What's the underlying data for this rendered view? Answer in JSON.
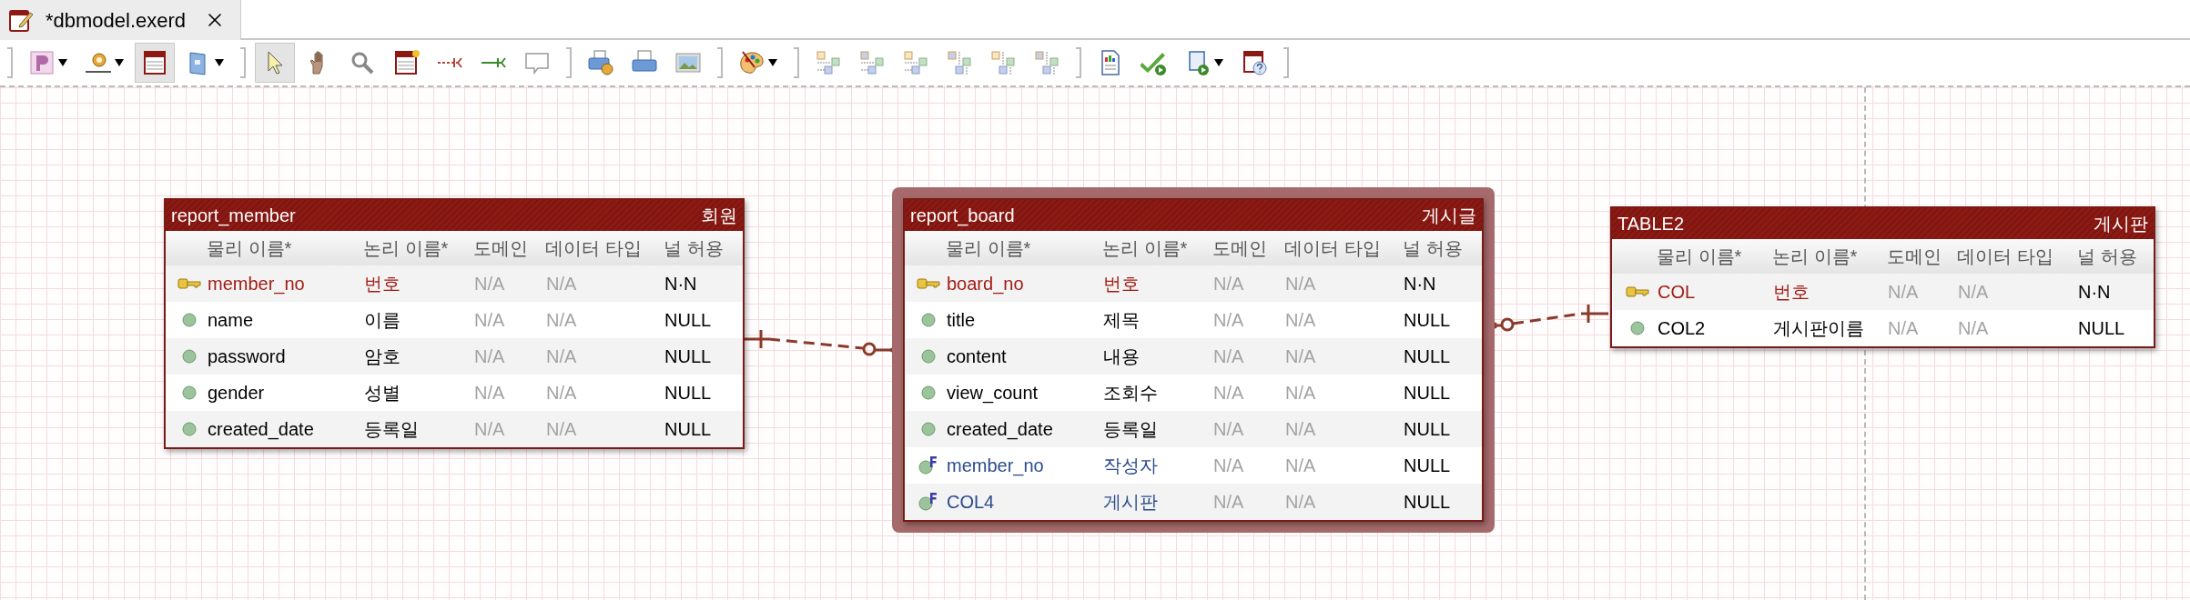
{
  "tab": {
    "title": "*dbmodel.exerd",
    "selected": true
  },
  "toolbar": {
    "groups": [
      [
        {
          "kind": "logical-view",
          "dropdown": true,
          "pressed": false
        },
        {
          "kind": "gear-line",
          "dropdown": true,
          "pressed": false
        },
        {
          "kind": "table-view",
          "dropdown": false,
          "pressed": true
        },
        {
          "kind": "book",
          "dropdown": true,
          "pressed": false
        }
      ],
      [
        {
          "kind": "pointer",
          "dropdown": false,
          "pressed": true
        },
        {
          "kind": "hand",
          "dropdown": false,
          "pressed": false
        },
        {
          "kind": "zoom",
          "dropdown": false,
          "pressed": false
        },
        {
          "kind": "new-table",
          "dropdown": false,
          "pressed": false
        },
        {
          "kind": "dashed-relation",
          "dropdown": false,
          "pressed": false
        },
        {
          "kind": "solid-relation",
          "dropdown": false,
          "pressed": false
        },
        {
          "kind": "note",
          "dropdown": false,
          "pressed": false
        }
      ],
      [
        {
          "kind": "print-settings",
          "dropdown": false,
          "pressed": false
        },
        {
          "kind": "print",
          "dropdown": false,
          "pressed": false
        },
        {
          "kind": "image",
          "dropdown": false,
          "pressed": false
        }
      ],
      [
        {
          "kind": "palette",
          "dropdown": true,
          "pressed": false
        }
      ],
      [
        {
          "kind": "layout-a",
          "dropdown": false,
          "pressed": false
        },
        {
          "kind": "layout-b",
          "dropdown": false,
          "pressed": false
        },
        {
          "kind": "layout-c",
          "dropdown": false,
          "pressed": false
        },
        {
          "kind": "layout-d",
          "dropdown": false,
          "pressed": false
        },
        {
          "kind": "layout-e",
          "dropdown": false,
          "pressed": false
        },
        {
          "kind": "layout-f",
          "dropdown": false,
          "pressed": false
        }
      ],
      [
        {
          "kind": "report",
          "dropdown": false,
          "pressed": false
        },
        {
          "kind": "validate",
          "dropdown": false,
          "pressed": false
        },
        {
          "kind": "script",
          "dropdown": true,
          "pressed": false
        },
        {
          "kind": "help",
          "dropdown": false,
          "pressed": false
        }
      ]
    ]
  },
  "tables": [
    {
      "name": "report_member",
      "logical_name": "회원",
      "selected": false,
      "headers": [
        "물리 이름*",
        "논리 이름*",
        "도메인",
        "데이터 타입",
        "널 허용"
      ],
      "rows": [
        {
          "kind": "pk",
          "physical": "member_no",
          "logical": "번호",
          "domain": "N/A",
          "type": "N/A",
          "nullable": "N·N"
        },
        {
          "kind": "attr",
          "physical": "name",
          "logical": "이름",
          "domain": "N/A",
          "type": "N/A",
          "nullable": "NULL"
        },
        {
          "kind": "attr",
          "physical": "password",
          "logical": "암호",
          "domain": "N/A",
          "type": "N/A",
          "nullable": "NULL"
        },
        {
          "kind": "attr",
          "physical": "gender",
          "logical": "성별",
          "domain": "N/A",
          "type": "N/A",
          "nullable": "NULL"
        },
        {
          "kind": "attr",
          "physical": "created_date",
          "logical": "등록일",
          "domain": "N/A",
          "type": "N/A",
          "nullable": "NULL"
        }
      ]
    },
    {
      "name": "report_board",
      "logical_name": "게시글",
      "selected": true,
      "headers": [
        "물리 이름*",
        "논리 이름*",
        "도메인",
        "데이터 타입",
        "널 허용"
      ],
      "rows": [
        {
          "kind": "pk",
          "physical": "board_no",
          "logical": "번호",
          "domain": "N/A",
          "type": "N/A",
          "nullable": "N·N"
        },
        {
          "kind": "attr",
          "physical": "title",
          "logical": "제목",
          "domain": "N/A",
          "type": "N/A",
          "nullable": "NULL"
        },
        {
          "kind": "attr",
          "physical": "content",
          "logical": "내용",
          "domain": "N/A",
          "type": "N/A",
          "nullable": "NULL"
        },
        {
          "kind": "attr",
          "physical": "view_count",
          "logical": "조회수",
          "domain": "N/A",
          "type": "N/A",
          "nullable": "NULL"
        },
        {
          "kind": "attr",
          "physical": "created_date",
          "logical": "등록일",
          "domain": "N/A",
          "type": "N/A",
          "nullable": "NULL"
        },
        {
          "kind": "fk",
          "physical": "member_no",
          "logical": "작성자",
          "domain": "N/A",
          "type": "N/A",
          "nullable": "NULL"
        },
        {
          "kind": "fk",
          "physical": "COL4",
          "logical": "게시판",
          "domain": "N/A",
          "type": "N/A",
          "nullable": "NULL"
        }
      ]
    },
    {
      "name": "TABLE2",
      "logical_name": "게시판",
      "selected": false,
      "headers": [
        "물리 이름*",
        "논리 이름*",
        "도메인",
        "데이터 타입",
        "널 허용"
      ],
      "rows": [
        {
          "kind": "pk",
          "physical": "COL",
          "logical": "번호",
          "domain": "N/A",
          "type": "N/A",
          "nullable": "N·N"
        },
        {
          "kind": "attr",
          "physical": "COL2",
          "logical": "게시판이름",
          "domain": "N/A",
          "type": "N/A",
          "nullable": "NULL"
        }
      ]
    }
  ]
}
